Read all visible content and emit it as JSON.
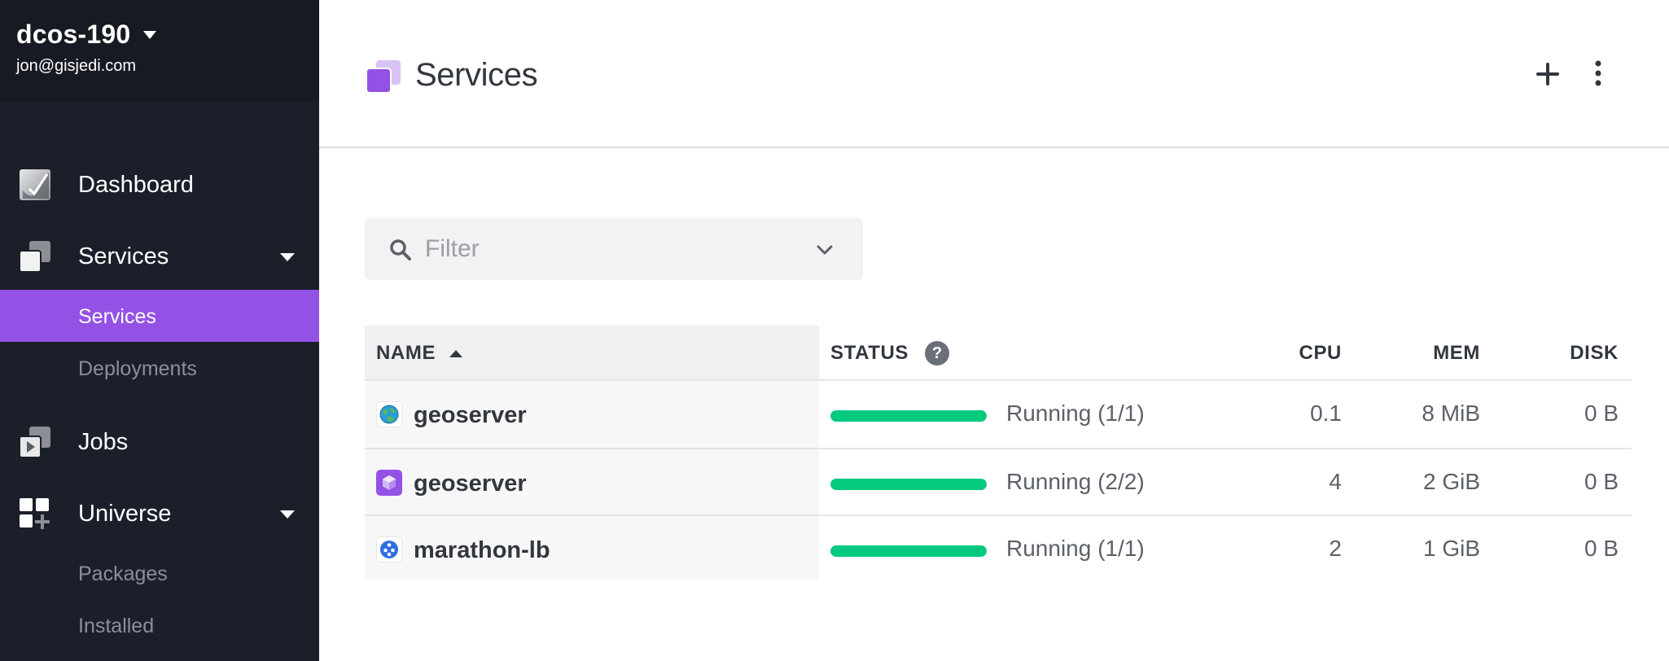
{
  "sidebar": {
    "cluster_name": "dcos-190",
    "user_email": "jon@gisjedi.com",
    "nav": {
      "dashboard": {
        "label": "Dashboard",
        "icon": "dashboard-icon"
      },
      "services": {
        "label": "Services",
        "icon": "services-icon"
      },
      "services_sub": {
        "services": "Services",
        "deployments": "Deployments"
      },
      "jobs": {
        "label": "Jobs",
        "icon": "jobs-icon"
      },
      "universe": {
        "label": "Universe",
        "icon": "universe-icon"
      },
      "universe_sub": {
        "packages": "Packages",
        "installed": "Installed"
      }
    },
    "active_item": "Services"
  },
  "header": {
    "title": "Services",
    "add_icon": "plus-icon",
    "more_icon": "more-vertical-icon"
  },
  "filter": {
    "placeholder": "Filter",
    "value": ""
  },
  "table": {
    "columns": {
      "name": "NAME",
      "status": "STATUS",
      "cpu": "CPU",
      "mem": "MEM",
      "disk": "DISK"
    },
    "sort": {
      "column": "NAME",
      "direction": "ascending"
    },
    "rows": [
      {
        "name": "geoserver",
        "icon": "globe-icon",
        "status": "Running (1/1)",
        "status_progress": 1.0,
        "cpu": "0.1",
        "mem": "8 MiB",
        "disk": "0 B"
      },
      {
        "name": "geoserver",
        "icon": "cube-icon",
        "status": "Running (2/2)",
        "status_progress": 1.0,
        "cpu": "4",
        "mem": "2 GiB",
        "disk": "0 B"
      },
      {
        "name": "marathon-lb",
        "icon": "network-icon",
        "status": "Running (1/1)",
        "status_progress": 1.0,
        "cpu": "2",
        "mem": "1 GiB",
        "disk": "0 B"
      }
    ]
  },
  "colors": {
    "sidebar_bg": "#1b1f2a",
    "active_item": "#9351e5",
    "status_running": "#04c97e",
    "brand_purple": "#9351e5"
  }
}
